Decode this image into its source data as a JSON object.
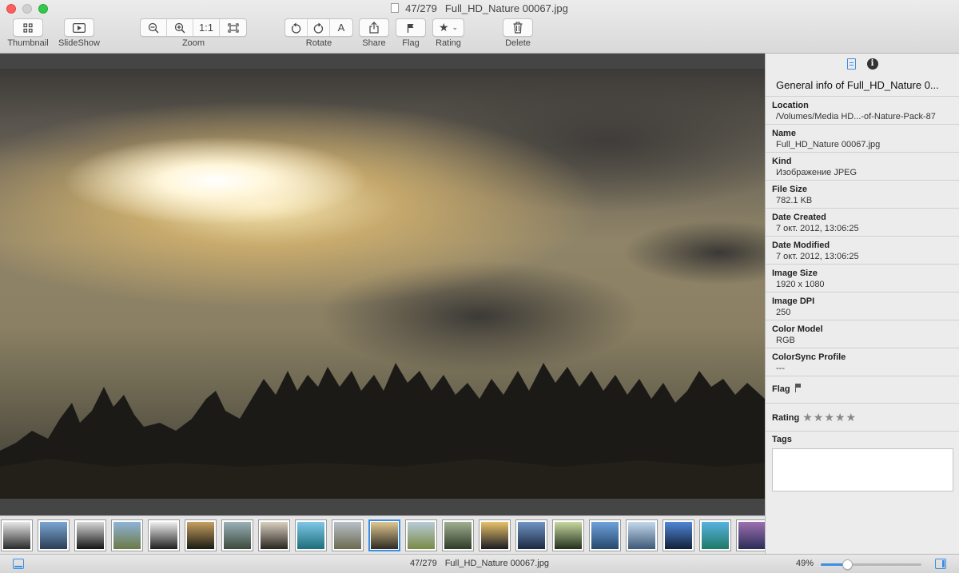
{
  "window": {
    "counter": "47/279",
    "title": "Full_HD_Nature 00067.jpg"
  },
  "toolbar": {
    "thumbnail_label": "Thumbnail",
    "slideshow_label": "SlideShow",
    "zoom_label": "Zoom",
    "zoom_actual": "1:1",
    "rotate_label": "Rotate",
    "auto_label": "A",
    "share_label": "Share",
    "flag_label": "Flag",
    "rating_label": "Rating",
    "delete_label": "Delete"
  },
  "panel": {
    "title": "General info of Full_HD_Nature 0...",
    "fields": [
      {
        "label": "Location",
        "value": "/Volumes/Media HD...-of-Nature-Pack-87"
      },
      {
        "label": "Name",
        "value": "Full_HD_Nature 00067.jpg"
      },
      {
        "label": "Kind",
        "value": "Изображение JPEG"
      },
      {
        "label": "File Size",
        "value": "782.1 KB"
      },
      {
        "label": "Date Created",
        "value": "7 окт. 2012, 13:06:25"
      },
      {
        "label": "Date Modified",
        "value": "7 окт. 2012, 13:06:25"
      },
      {
        "label": "Image Size",
        "value": "1920 x 1080"
      },
      {
        "label": "Image DPI",
        "value": "250"
      },
      {
        "label": "Color Model",
        "value": "RGB"
      },
      {
        "label": "ColorSync Profile",
        "value": "---"
      }
    ],
    "flag_label": "Flag",
    "rating_label": "Rating",
    "rating_stars": "★★★★★",
    "tags_label": "Tags"
  },
  "status": {
    "counter": "47/279",
    "filename": "Full_HD_Nature 00067.jpg",
    "zoom": "49%",
    "zoom_level": 0.26
  },
  "filmstrip": [
    {
      "colors": [
        "#e8e8e8",
        "#2a2a2a"
      ]
    },
    {
      "colors": [
        "#7aa6d2",
        "#2b3d55"
      ]
    },
    {
      "colors": [
        "#d8d8d8",
        "#151515"
      ]
    },
    {
      "colors": [
        "#8fb3d8",
        "#6b7a45"
      ]
    },
    {
      "colors": [
        "#f0f0f0",
        "#202020"
      ]
    },
    {
      "colors": [
        "#c7a060",
        "#1a1a14"
      ]
    },
    {
      "colors": [
        "#9ab1b8",
        "#3b4a3c"
      ]
    },
    {
      "colors": [
        "#d9d0c0",
        "#2a2620"
      ]
    },
    {
      "colors": [
        "#7fc6e8",
        "#1d6f7a"
      ]
    },
    {
      "colors": [
        "#b8c0c8",
        "#6c6a50"
      ]
    },
    {
      "colors": [
        "#e0c890",
        "#2e2b22"
      ]
    },
    {
      "colors": [
        "#b8ccd8",
        "#7a8a45"
      ]
    },
    {
      "colors": [
        "#9fb090",
        "#2f3a28"
      ]
    },
    {
      "colors": [
        "#e9c26a",
        "#1c1d24"
      ]
    },
    {
      "colors": [
        "#6f94c4",
        "#1c2a40"
      ]
    },
    {
      "colors": [
        "#c8d8a0",
        "#22301c"
      ]
    },
    {
      "colors": [
        "#6fa2dc",
        "#26486c"
      ]
    },
    {
      "colors": [
        "#c4d8ec",
        "#3d5a78"
      ]
    },
    {
      "colors": [
        "#4f86d6",
        "#12203a"
      ]
    },
    {
      "colors": [
        "#58b2e0",
        "#1f7a66"
      ]
    },
    {
      "colors": [
        "#9d70b0",
        "#2a2d58"
      ]
    }
  ],
  "selected_thumb": 10
}
